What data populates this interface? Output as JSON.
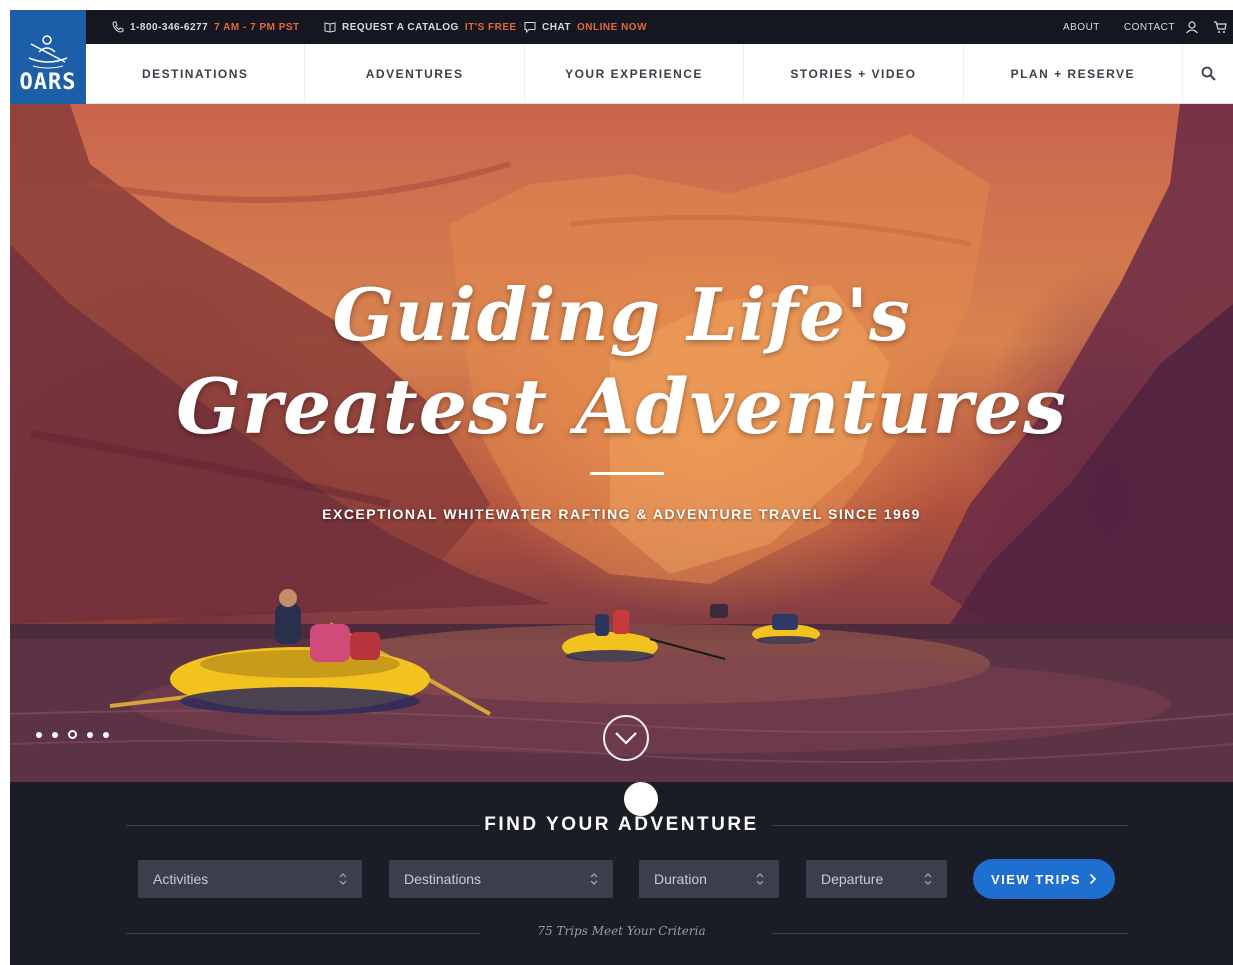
{
  "topbar": {
    "phone": "1-800-346-6277",
    "hours": "7 AM - 7 PM PST",
    "catalog_label": "REQUEST A CATALOG",
    "catalog_note": "IT'S FREE",
    "chat_label": "CHAT",
    "chat_status": "ONLINE NOW",
    "about": "ABOUT",
    "contact": "CONTACT"
  },
  "logo": {
    "text": "OARS"
  },
  "nav": {
    "items": [
      {
        "label": "DESTINATIONS"
      },
      {
        "label": "ADVENTURES"
      },
      {
        "label": "YOUR EXPERIENCE"
      },
      {
        "label": "STORIES + VIDEO"
      },
      {
        "label": "PLAN + RESERVE"
      }
    ],
    "search_icon": "search-icon"
  },
  "hero": {
    "headline_line1": "Guiding Life's",
    "headline_line2": "Greatest Adventures",
    "tagline": "EXCEPTIONAL WHITEWATER RAFTING & ADVENTURE TRAVEL SINCE 1969",
    "slides_total": 5,
    "active_slide": 3
  },
  "finder": {
    "title": "FIND YOUR ADVENTURE",
    "selects": {
      "activities": "Activities",
      "destinations": "Destinations",
      "duration": "Duration",
      "departure": "Departure"
    },
    "cta": "VIEW TRIPS",
    "count": "75 Trips Meet Your Criteria"
  },
  "colors": {
    "topbar_bg": "#14171f",
    "accent_orange": "#e8683a",
    "logo_blue": "#1d5ea8",
    "cta_blue": "#1f6fd0",
    "finder_bg": "#1a1c26"
  }
}
